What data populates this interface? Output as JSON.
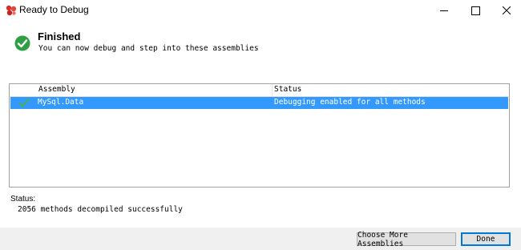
{
  "window": {
    "title": "Ready to Debug",
    "icon": "app-logo-icon",
    "controls": {
      "minimize": "minimize-icon",
      "maximize": "maximize-icon",
      "close": "close-icon"
    }
  },
  "header": {
    "title": "Finished",
    "subtitle": "You can now debug and step into these assemblies",
    "icon": "success-check-icon"
  },
  "assemblies": {
    "columns": [
      "Assembly",
      "Status"
    ],
    "rows": [
      {
        "assembly": "MySql.Data",
        "status": "Debugging enabled for all methods",
        "selected": true,
        "icon": "checkmark-icon"
      }
    ]
  },
  "status": {
    "label": "Status:",
    "text": "2056 methods decompiled successfully"
  },
  "footer": {
    "more_label": "Choose More Assemblies",
    "done_label": "Done"
  },
  "colors": {
    "selection": "#3399ff",
    "success": "#2ea043",
    "accent": "#0078d7"
  }
}
